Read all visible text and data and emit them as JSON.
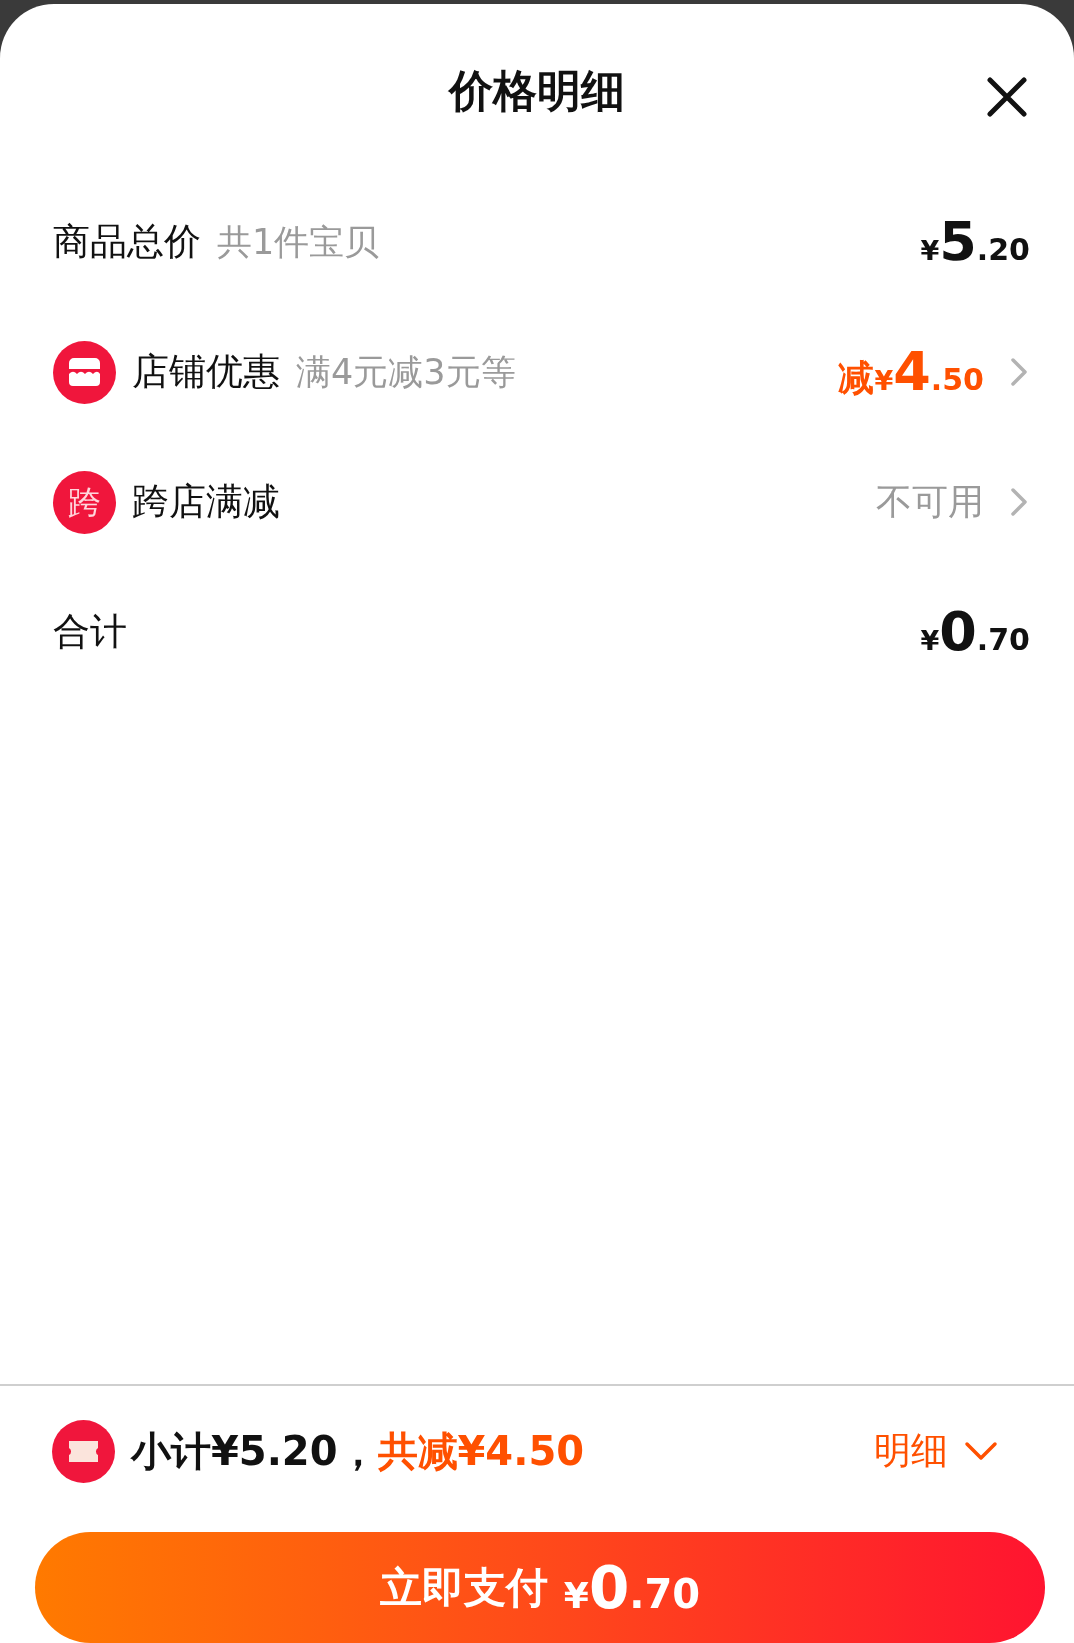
{
  "title": "价格明细",
  "rows": [
    {
      "kind": "plain",
      "label": "商品总价",
      "note": "共1件宝贝",
      "value": {
        "currency": "¥",
        "integer": "5",
        "decimal": ".20"
      },
      "arrow": false
    },
    {
      "kind": "shop",
      "label": "店铺优惠",
      "note": "满4元减3元等",
      "value": {
        "prefix": "减",
        "currency": "¥",
        "integer": "4",
        "decimal": ".50"
      },
      "arrow": true
    },
    {
      "kind": "cross",
      "badge": "跨",
      "label": "跨店满减",
      "status": "不可用",
      "arrow": true
    },
    {
      "kind": "plain",
      "label": "合计",
      "value": {
        "currency": "¥",
        "integer": "0",
        "decimal": ".70"
      },
      "arrow": false
    }
  ],
  "summary": {
    "subtotal": "小计¥5.20，",
    "savings": "共减¥4.50",
    "toggle": "明细"
  },
  "pay_button": {
    "label": "立即支付",
    "currency": "¥",
    "integer": "0",
    "decimal": ".70"
  }
}
